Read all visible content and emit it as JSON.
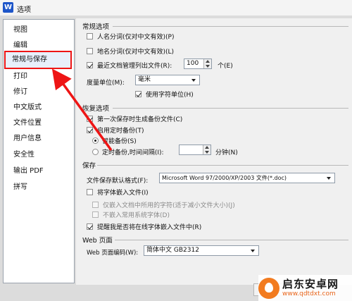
{
  "window": {
    "title": "选项",
    "app_icon": "W"
  },
  "sidebar": {
    "items": [
      {
        "label": "视图"
      },
      {
        "label": "编辑"
      },
      {
        "label": "常规与保存",
        "selected": true
      },
      {
        "label": "打印"
      },
      {
        "label": "修订"
      },
      {
        "label": "中文版式"
      },
      {
        "label": "文件位置"
      },
      {
        "label": "用户信息"
      },
      {
        "label": "安全性"
      },
      {
        "label": "输出 PDF"
      },
      {
        "label": "拼写"
      }
    ]
  },
  "general": {
    "title": "常规选项",
    "name_seg": {
      "label": "人名分词(仅对中文有效)(P)",
      "checked": false
    },
    "place_seg": {
      "label": "地名分词(仅对中文有效)(L)",
      "checked": false
    },
    "recent": {
      "label": "最近文档管理列出文件(R):",
      "value": "100",
      "unit": "个(E)",
      "checked": true
    },
    "unit": {
      "label": "度量单位(M):",
      "value": "毫米"
    },
    "char_unit": {
      "label": "使用字符单位(H)",
      "checked": true
    }
  },
  "recovery": {
    "title": "恢复选项",
    "first_backup": {
      "label": "第一次保存时生成备份文件(C)",
      "checked": true
    },
    "timed_backup": {
      "label": "启用定时备份(T)",
      "checked": true
    },
    "smart": {
      "label": "智能备份(S)",
      "selected": true
    },
    "timed": {
      "label": "定时备份,时间间隔(I):",
      "unit": "分钟(N)",
      "value": ""
    }
  },
  "save": {
    "title": "保存",
    "format": {
      "label": "文件保存默认格式(F):",
      "value": "Microsoft Word 97/2000/XP/2003 文件(*.doc)"
    },
    "embed": {
      "label": "将字体嵌入文件(I)",
      "checked": false
    },
    "embed_used": {
      "label": "仅嵌入文档中所用的字符(适于减小文件大小)(J)"
    },
    "no_common": {
      "label": "不嵌入常用系统字体(D)"
    },
    "remind": {
      "label": "提醒我是否将在线字体嵌入文件中(R)",
      "checked": true
    }
  },
  "web": {
    "title": "Web 页面",
    "encoding": {
      "label": "Web 页面编码(W):",
      "value": "简体中文 GB2312"
    }
  },
  "watermark": {
    "name": "启东安卓网",
    "url": "www.qdtdxt.com"
  },
  "colors": {
    "annotation": "#ee1515",
    "brand_orange": "#f27b1f",
    "app_blue": "#1e56c9"
  }
}
